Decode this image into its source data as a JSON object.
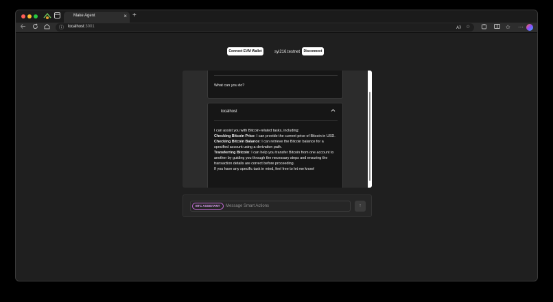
{
  "browser": {
    "tab_title": "Make Agent",
    "tab_close": "×",
    "new_tab": "+",
    "url_host": "localhost",
    "url_port": ":3001",
    "icons": [
      "back-icon",
      "forward-icon",
      "reload-icon",
      "home-icon",
      "info-icon",
      "read-aloud-icon",
      "star-icon",
      "extensions-icon",
      "split-screen-icon",
      "favorites-icon",
      "more-icon",
      "profile-icon"
    ]
  },
  "header": {
    "connect_label": "Connect EVM Wallet",
    "account": "syi216.testnet",
    "disconnect_label": "Disconnect"
  },
  "chat": {
    "user_message": "What can you do?",
    "assistant_source": "localhost",
    "response": {
      "intro": "I can assist you with Bitcoin-related tasks, including:",
      "items": [
        {
          "title": "Checking Bitcoin Price",
          "text": ": I can provide the current price of Bitcoin in USD."
        },
        {
          "title": "Checking Bitcoin Balance",
          "text": ": I can retrieve the Bitcoin balance for a specified account using a derivation path."
        },
        {
          "title": "Transferring Bitcoin",
          "text": ": I can help you transfer Bitcoin from one account to another by guiding you through the necessary steps and ensuring the transaction details are correct before proceeding."
        }
      ],
      "outro": "If you have any specific task in mind, feel free to let me know!"
    }
  },
  "composer": {
    "badge": "BTC ASSISTANT",
    "placeholder": "Message Smart Actions",
    "send_glyph": "↑"
  },
  "colors": {
    "badge_accent": "#c66bd9",
    "page_bg": "#1f1f1f"
  }
}
